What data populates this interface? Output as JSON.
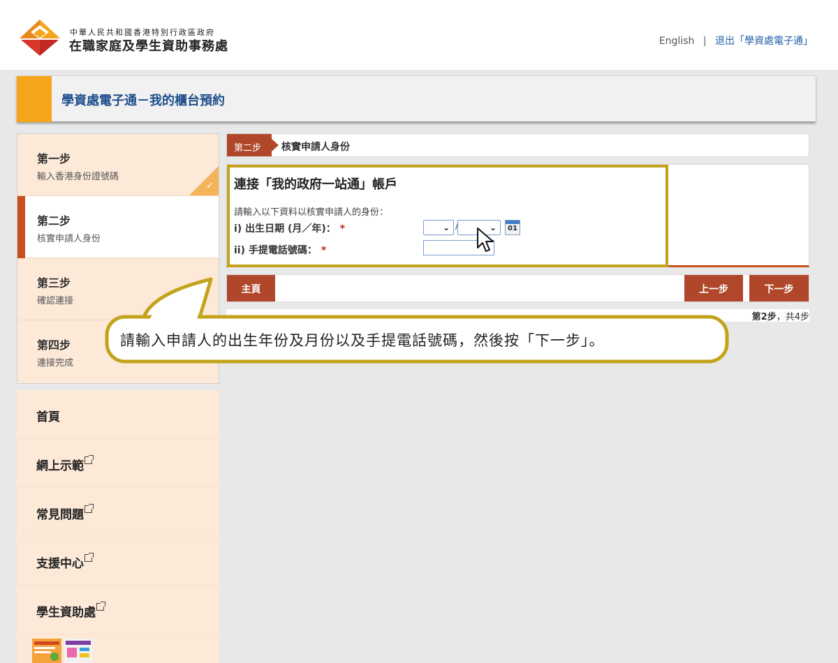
{
  "header": {
    "gov_name": "中華人民共和國香港特別行政區政府",
    "dept_name": "在職家庭及學生資助事務處",
    "lang_link": "English",
    "separator": "|",
    "logout_link": "退出「學資處電子通」"
  },
  "page": {
    "title": "學資處電子通－我的櫃台預約"
  },
  "steps": [
    {
      "number": "第一步",
      "label": "輸入香港身份證號碼",
      "status": "completed"
    },
    {
      "number": "第二步",
      "label": "核實申請人身份",
      "status": "active"
    },
    {
      "number": "第三步",
      "label": "確認連接",
      "status": "pending"
    },
    {
      "number": "第四步",
      "label": "連接完成",
      "status": "pending"
    }
  ],
  "nav": {
    "items": [
      {
        "label": "首頁",
        "external": false
      },
      {
        "label": "網上示範",
        "external": true
      },
      {
        "label": "常見問題",
        "external": true
      },
      {
        "label": "支援中心",
        "external": true
      },
      {
        "label": "學生資助處",
        "external": true
      }
    ]
  },
  "step_header": {
    "badge": "第二步",
    "name": "核實申請人身份"
  },
  "form": {
    "title": "連接「我的政府一站通」帳戶",
    "intro": "請輸入以下資料以核實申請人的身份：",
    "dob_label": "i) 出生日期 (月／年)：",
    "phone_label": "ii) 手提電話號碼：",
    "required_mark": "*",
    "month_value": "",
    "year_value": "",
    "date_separator": "/",
    "calendar_day": "01",
    "phone_value": ""
  },
  "actions": {
    "home": "主頁",
    "prev": "上一步",
    "next": "下一步"
  },
  "progress": {
    "current": "第2步",
    "sep": "，",
    "total": "共4步"
  },
  "callout": {
    "text": "請輸入申請人的出生年份及月份以及手提電話號碼，然後按「下一步」。"
  },
  "colors": {
    "accent_orange": "#f4a51c",
    "step_red": "#b0472a",
    "active_bar": "#c7501e",
    "callout_border": "#c2a31b",
    "link_blue": "#1f5fa8"
  }
}
